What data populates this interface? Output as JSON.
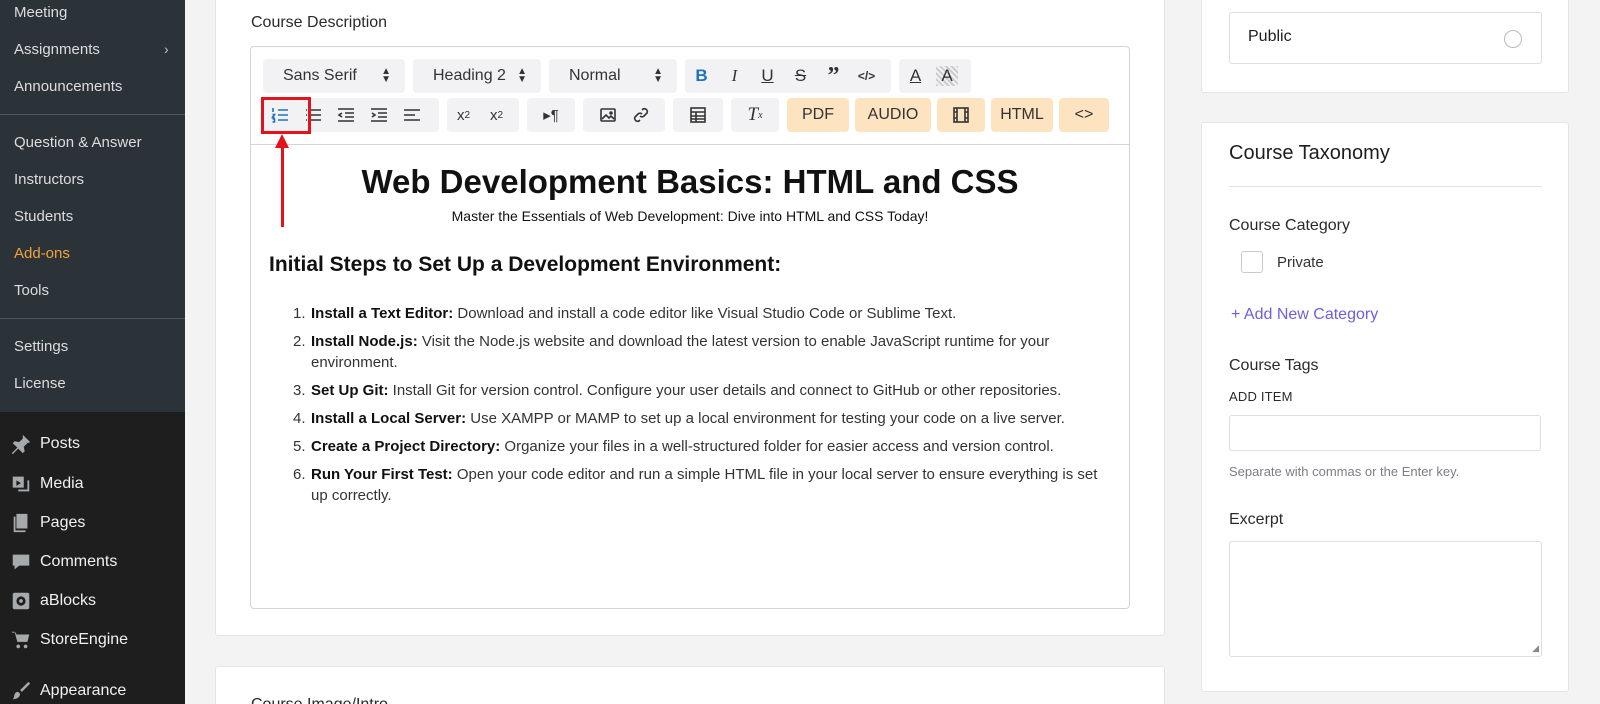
{
  "sidebar": {
    "sub_items": [
      {
        "label": "Meeting"
      },
      {
        "label": "Assignments",
        "chevron": "›"
      },
      {
        "label": "Announcements"
      },
      {
        "label": "Question & Answer"
      },
      {
        "label": "Instructors"
      },
      {
        "label": "Students"
      },
      {
        "label": "Add-ons"
      },
      {
        "label": "Tools"
      },
      {
        "label": "Settings"
      },
      {
        "label": "License"
      }
    ],
    "main_items": [
      {
        "label": "Posts",
        "icon": "pin-icon"
      },
      {
        "label": "Media",
        "icon": "media-icon"
      },
      {
        "label": "Pages",
        "icon": "pages-icon"
      },
      {
        "label": "Comments",
        "icon": "comments-icon"
      },
      {
        "label": "aBlocks",
        "icon": "ablocks-icon"
      },
      {
        "label": "StoreEngine",
        "icon": "cart-icon"
      },
      {
        "label": "Appearance",
        "icon": "brush-icon"
      }
    ]
  },
  "main": {
    "section_label": "Course Description",
    "next_section_label": "Course Image/Intro",
    "toolbar": {
      "font_select": "Sans Serif",
      "heading_select": "Heading 2",
      "size_select": "Normal",
      "pdf": "PDF",
      "audio": "AUDIO",
      "html": "HTML",
      "code": "<>"
    },
    "doc": {
      "title": "Web Development Basics: HTML and CSS",
      "subtitle": "Master the Essentials of Web Development: Dive into HTML and CSS Today!",
      "heading": "Initial Steps to Set Up a Development Environment:",
      "steps": [
        {
          "num": "1.",
          "bold": "Install a Text Editor:",
          "text": " Download and install a code editor like Visual Studio Code or Sublime Text."
        },
        {
          "num": "2.",
          "bold": "Install Node.js:",
          "text": " Visit the Node.js website and download the latest version to enable JavaScript runtime for your environment."
        },
        {
          "num": "3.",
          "bold": "Set Up Git:",
          "text": " Install Git for version control. Configure your user details and connect to GitHub or other repositories."
        },
        {
          "num": "4.",
          "bold": "Install a Local Server:",
          "text": " Use XAMPP or MAMP to set up a local environment for testing your code on a live server."
        },
        {
          "num": "5.",
          "bold": "Create a Project Directory:",
          "text": " Organize your files in a well-structured folder for easier access and version control."
        },
        {
          "num": "6.",
          "bold": "Run Your First Test:",
          "text": " Open your code editor and run a simple HTML file in your local server to ensure everything is set up correctly."
        }
      ]
    }
  },
  "right": {
    "visibility_option": "Public",
    "taxonomy_title": "Course Taxonomy",
    "category_label": "Course Category",
    "category_option": "Private",
    "add_category": "+ Add New Category",
    "tags_label": "Course Tags",
    "add_item_label": "ADD ITEM",
    "tags_hint": "Separate with commas or the Enter key.",
    "excerpt_label": "Excerpt"
  }
}
